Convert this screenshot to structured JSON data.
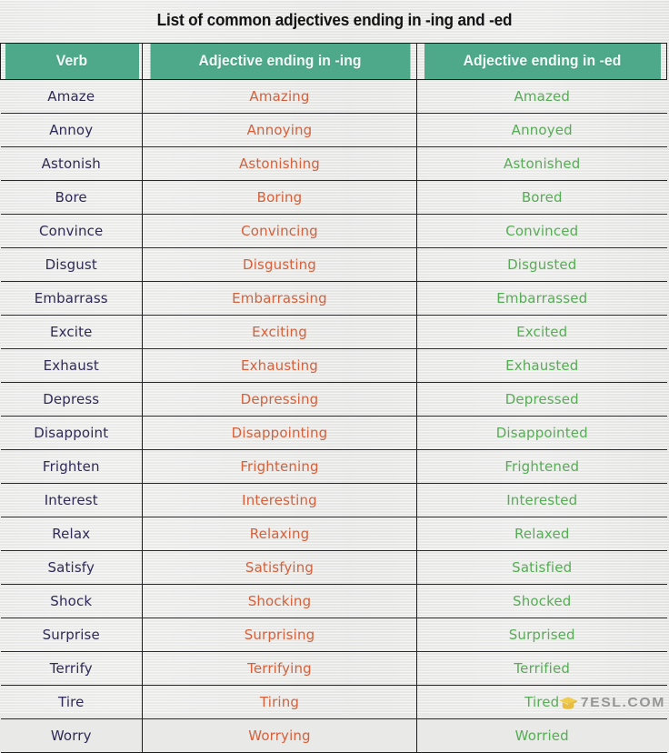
{
  "document": {
    "title": "List of common adjectives ending in -ing and -ed"
  },
  "table": {
    "headers": {
      "verb": "Verb",
      "adjective_ing": "Adjective ending in -ing",
      "adjective_ed": "Adjective ending in -ed"
    },
    "colors": {
      "header_background": "#4ea88a",
      "header_text": "#f4faf7",
      "verb_text": "#2f2a56",
      "ing_text": "#d4613c",
      "ed_text": "#56ad55",
      "page_background": "#e9e9e7",
      "border": "#1b1b1b"
    },
    "rows": [
      {
        "verb": "Amaze",
        "ing": "Amazing",
        "ed": "Amazed"
      },
      {
        "verb": "Annoy",
        "ing": "Annoying",
        "ed": "Annoyed"
      },
      {
        "verb": "Astonish",
        "ing": "Astonishing",
        "ed": "Astonished"
      },
      {
        "verb": "Bore",
        "ing": "Boring",
        "ed": "Bored"
      },
      {
        "verb": "Convince",
        "ing": "Convincing",
        "ed": "Convinced"
      },
      {
        "verb": "Disgust",
        "ing": "Disgusting",
        "ed": "Disgusted"
      },
      {
        "verb": "Embarrass",
        "ing": "Embarrassing",
        "ed": "Embarrassed"
      },
      {
        "verb": "Excite",
        "ing": "Exciting",
        "ed": "Excited"
      },
      {
        "verb": "Exhaust",
        "ing": "Exhausting",
        "ed": "Exhausted"
      },
      {
        "verb": "Depress",
        "ing": "Depressing",
        "ed": "Depressed"
      },
      {
        "verb": "Disappoint",
        "ing": "Disappointing",
        "ed": "Disappointed"
      },
      {
        "verb": "Frighten",
        "ing": "Frightening",
        "ed": "Frightened"
      },
      {
        "verb": "Interest",
        "ing": "Interesting",
        "ed": "Interested"
      },
      {
        "verb": "Relax",
        "ing": "Relaxing",
        "ed": "Relaxed"
      },
      {
        "verb": "Satisfy",
        "ing": "Satisfying",
        "ed": "Satisfied"
      },
      {
        "verb": "Shock",
        "ing": "Shocking",
        "ed": "Shocked"
      },
      {
        "verb": "Surprise",
        "ing": "Surprising",
        "ed": "Surprised"
      },
      {
        "verb": "Terrify",
        "ing": "Terrifying",
        "ed": "Terrified"
      },
      {
        "verb": "Tire",
        "ing": "Tiring",
        "ed": "Tired"
      },
      {
        "verb": "Worry",
        "ing": "Worrying",
        "ed": "Worried"
      }
    ]
  },
  "watermark": {
    "text": "7ESL.COM",
    "icon": "graduation-cap-icon",
    "icon_color": "#e8b931"
  }
}
